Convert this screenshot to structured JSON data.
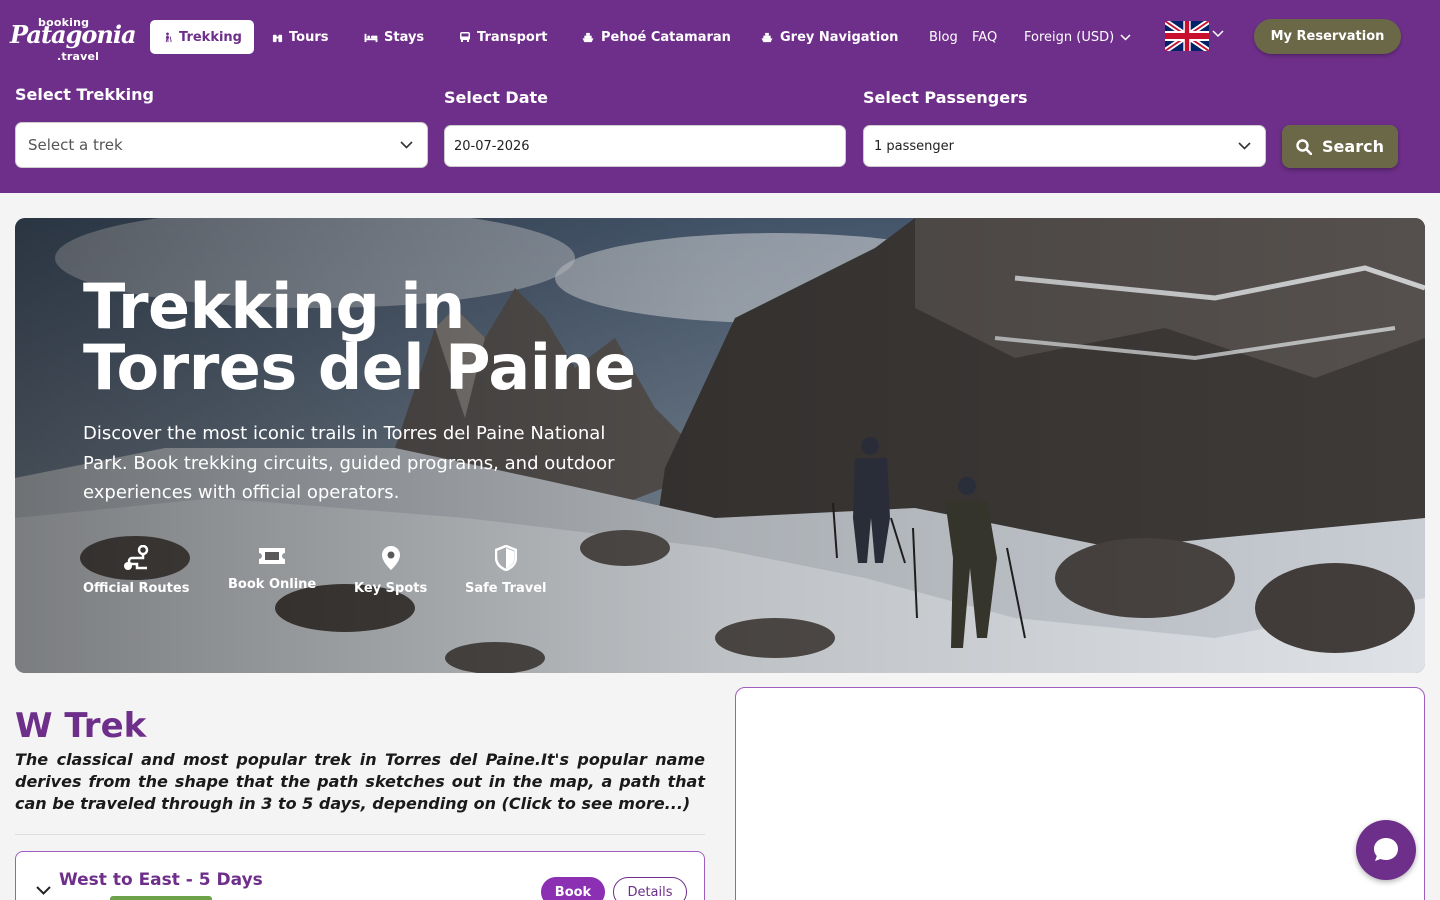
{
  "brand": {
    "top": "booking",
    "main": "Patagonia",
    "sub": ".travel"
  },
  "nav": [
    {
      "label": "Trekking",
      "icon": "hiker-icon"
    },
    {
      "label": "Tours",
      "icon": "binoculars-icon"
    },
    {
      "label": "Stays",
      "icon": "bed-icon"
    },
    {
      "label": "Transport",
      "icon": "bus-icon"
    },
    {
      "label": "Pehoé Catamaran",
      "icon": "ship-icon"
    },
    {
      "label": "Grey Navigation",
      "icon": "ship-icon"
    }
  ],
  "links": {
    "blog": "Blog",
    "faq": "FAQ"
  },
  "currency": "Foreign (USD)",
  "reservation_label": "My Reservation",
  "search": {
    "trek_label": "Select Trekking",
    "trek_placeholder": "Select a trek",
    "date_label": "Select Date",
    "date_value": "20-07-2026",
    "passengers_label": "Select Passengers",
    "passengers_value": "1 passenger",
    "button_label": "Search"
  },
  "hero": {
    "title_line1": "Trekking in",
    "title_line2": "Torres del Paine",
    "description": "Discover the most iconic trails in Torres del Paine National Park. Book trekking circuits, guided programs, and outdoor experiences with official operators.",
    "features": [
      {
        "label": "Official Routes",
        "icon": "route-icon"
      },
      {
        "label": "Book Online",
        "icon": "ticket-icon"
      },
      {
        "label": "Key Spots",
        "icon": "map-pin-icon"
      },
      {
        "label": "Safe Travel",
        "icon": "shield-icon"
      }
    ]
  },
  "trek": {
    "title": "W Trek",
    "description": "The classical and most popular trek in Torres del Paine.It's popular name derives from the shape that the path sketches out in the map, a path that can be traveled through in 3 to 5 days, depending on (Click to see more...)"
  },
  "route_card": {
    "title": "West to East - 5 Days",
    "book_label": "Book",
    "details_label": "Details"
  },
  "colors": {
    "brand_purple": "#6e2f8a",
    "olive": "#6b6848",
    "book_purple": "#8b2fb3",
    "tag_green": "#6ca34a"
  }
}
